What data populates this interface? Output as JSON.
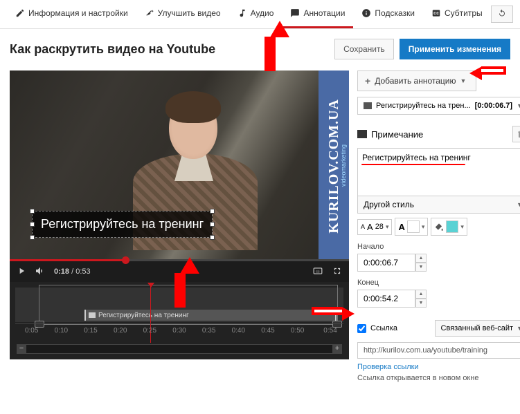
{
  "tabs": {
    "info": "Информация и настройки",
    "enhance": "Улучшить видео",
    "audio": "Аудио",
    "annotations": "Аннотации",
    "hints": "Подсказки",
    "subtitles": "Субтитры"
  },
  "video_title": "Как раскрутить видео на Youtube",
  "actions": {
    "save": "Сохранить",
    "apply": "Применить изменения"
  },
  "player": {
    "cur_time": "0:18",
    "duration": "0:53",
    "watermark_main": "KURILOV.COM.UA",
    "watermark_sub": "videomarketing",
    "overlay_text": "Регистрируйтесь на тренинг"
  },
  "timeline": {
    "item_label": "Регистрируйтесь на тренинг",
    "ticks": [
      "0:05",
      "0:10",
      "0:15",
      "0:20",
      "0:25",
      "0:30",
      "0:35",
      "0:40",
      "0:45",
      "0:50",
      "0:54"
    ]
  },
  "side": {
    "add_btn": "Добавить аннотацию",
    "list_item": {
      "label": "Регистрируйтесь на трен...",
      "time": "[0:00:06.7]"
    },
    "section_title": "Примечание",
    "textarea_value": "Регистрируйтесь на тренинг",
    "style_select": "Другой стиль",
    "font_size": "28",
    "start_label": "Начало",
    "start_value": "0:00:06.7",
    "end_label": "Конец",
    "end_value": "0:00:54.2",
    "link_label": "Ссылка",
    "link_type": "Связанный веб-сайт",
    "url": "http://kurilov.com.ua/youtube/training",
    "link_test": "Проверка ссылки",
    "link_note": "Ссылка открывается в новом окне"
  }
}
